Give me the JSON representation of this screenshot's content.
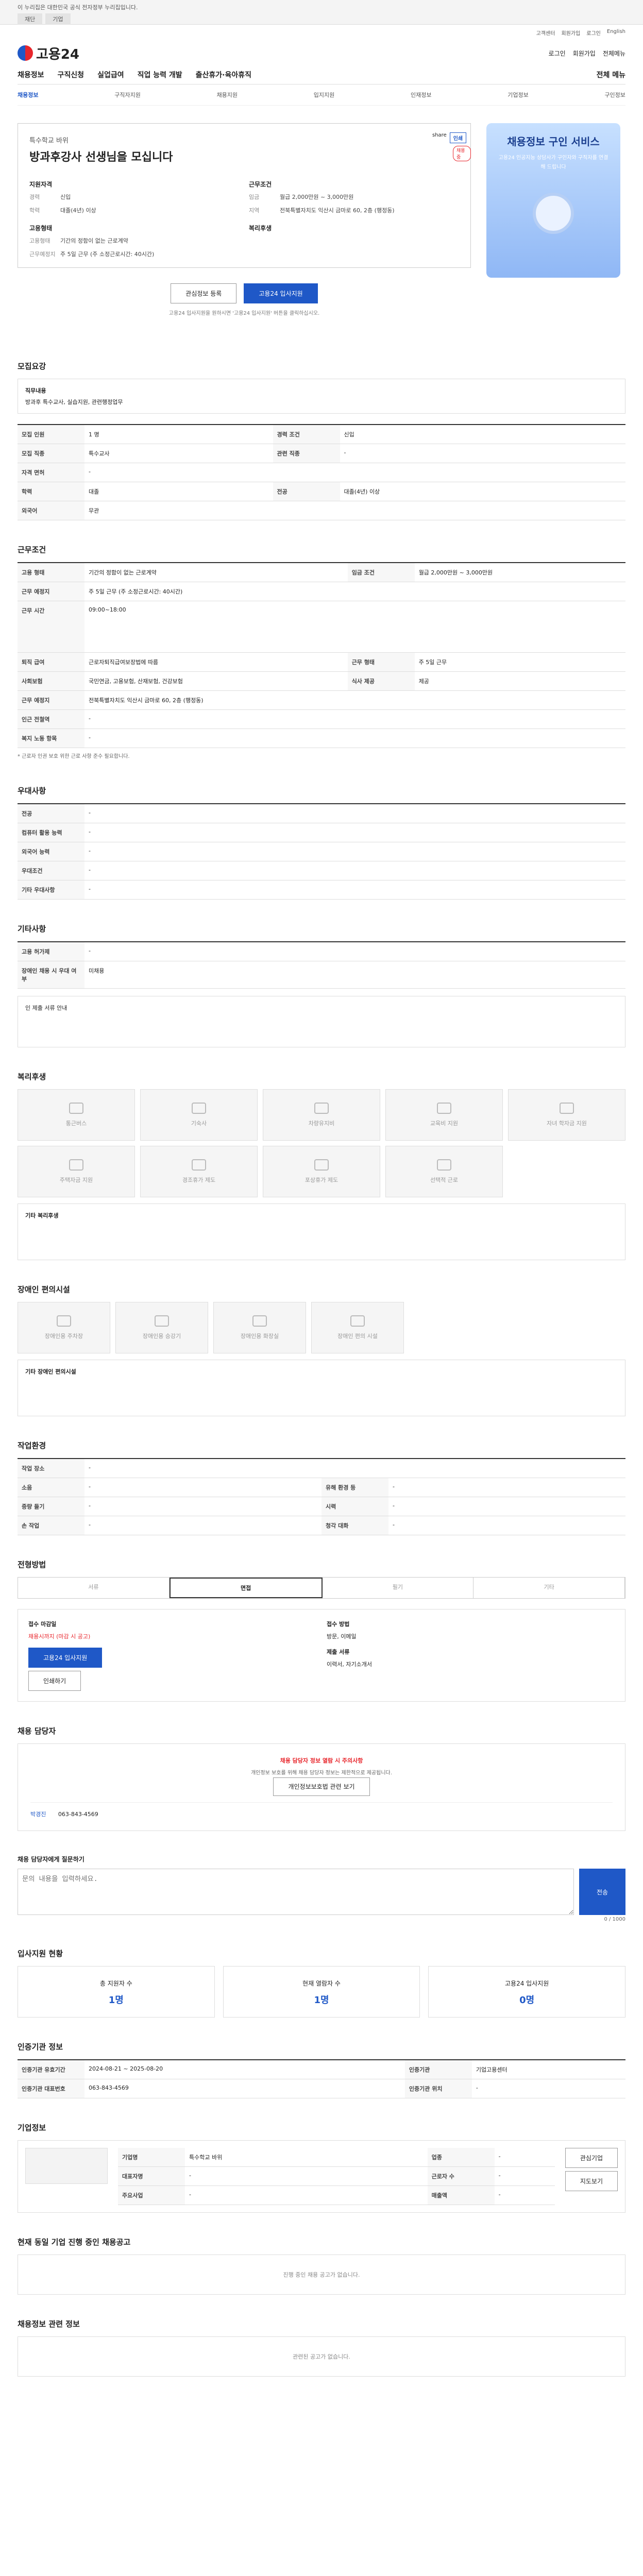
{
  "gov_banner": {
    "text": "이 누리집은 대한민국 공식 전자정부 누리집입니다.",
    "btn1": "재단",
    "btn2": "기업"
  },
  "util": [
    "고객센터",
    "회원가입",
    "로그인",
    "English"
  ],
  "header": {
    "logo": "고용24",
    "links": [
      "로그인",
      "회원가입",
      "전체메뉴"
    ]
  },
  "gnb": {
    "items": [
      "채용정보",
      "구직신청",
      "실업급여",
      "직업 능력 개발",
      "출산휴가·육아휴직"
    ],
    "right": "전체 메뉴"
  },
  "subnav": [
    "채용정보",
    "구직자지원",
    "채용지원",
    "입지지원",
    "인재정보",
    "기업정보",
    "구인정보"
  ],
  "job": {
    "company": "특수학교 바위",
    "title": "방과후강사 선생님을 모십니다",
    "share": "share",
    "print": "인쇄",
    "badge": "채용중",
    "left_heading": "지원자격",
    "left": [
      [
        "경력",
        "신입"
      ],
      [
        "학력",
        "대졸(4년) 이상"
      ]
    ],
    "left2_heading": "고용형태",
    "left2": [
      [
        "고용형태",
        "기간의 정함이 없는 근로계약"
      ],
      [
        "근무예정지",
        "주 5일 근무 (주 소정근로시간: 40시간)"
      ]
    ],
    "right_heading": "근무조건",
    "right": [
      [
        "임금",
        "월급 2,000만원 ~ 3,000만원"
      ],
      [
        "지역",
        "전북특별자치도 익산시 금마로 60, 2층 (행정동)"
      ]
    ],
    "right2_heading": "복리후생"
  },
  "ad": {
    "title": "채용정보 구인 서비스",
    "desc": "고용24 인공지능 상담사가 구인자와 구직자를 연결해 드립니다"
  },
  "actions": {
    "interest": "관심정보 등록",
    "apply": "고용24 입사지원"
  },
  "apply_note": "고용24 입사지원을 원하시면 '고용24 입사지원' 버튼을 클릭하십시오.",
  "sections": {
    "qual": "모집요강",
    "work": "근무조건",
    "pref": "우대사항",
    "etc": "기타사항",
    "welfare": "복리후생",
    "disabled": "장애인 편의시설",
    "env": "작업환경",
    "method": "전형방법",
    "manager": "채용 담당자",
    "status": "입사지원 현황",
    "cert": "인증기관 정보",
    "company": "기업정보",
    "similar": "현재 동일 기업 진행 중인 채용공고",
    "same": "채용정보 관련 정보"
  },
  "qual": {
    "summary_title": "직무내용",
    "summary": "방과후 특수교사, 실습지원, 관련행정업무",
    "rows": [
      [
        "모집 인원",
        "1 명",
        "경력 조건",
        "신입"
      ],
      [
        "모집 직종",
        "특수교사",
        "관련 직종",
        "-"
      ],
      [
        "자격 면허",
        "-",
        "",
        ""
      ],
      [
        "학력",
        "대졸",
        "전공",
        "대졸(4년) 이상"
      ],
      [
        "외국어",
        "무관",
        "",
        ""
      ]
    ]
  },
  "work": {
    "rows": [
      [
        "고용 형태",
        "기간의 정함이 없는 근로계약",
        "임금 조건",
        "월급 2,000만원 ~ 3,000만원"
      ],
      [
        "근무 예정지",
        "주 5일 근무 (주 소정근로시간: 40시간)",
        "",
        ""
      ],
      [
        "근무 시간",
        "09:00~18:00",
        "",
        ""
      ],
      [
        "퇴직 급여",
        "근로자퇴직급여보장법에 따름",
        "근무 형태",
        "주 5일 근무"
      ],
      [
        "사회보험",
        "국민연금, 고용보험, 산재보험, 건강보험",
        "식사 제공",
        "제공"
      ],
      [
        "근무 예정지",
        "전북특별자치도 익산시 금마로 60, 2층 (행정동)",
        "",
        ""
      ],
      [
        "인근 전철역",
        "-",
        "",
        ""
      ],
      [
        "복지 노동 항목",
        "-",
        "",
        ""
      ]
    ],
    "note": "* 근로자 인권 보호 위한 근로 사항 준수 필요합니다."
  },
  "pref": [
    [
      "전공",
      "-"
    ],
    [
      "컴퓨터 활용 능력",
      "-"
    ],
    [
      "외국어 능력",
      "-"
    ],
    [
      "우대조건",
      "-"
    ],
    [
      "기타 우대사항",
      "-"
    ]
  ],
  "etc": [
    [
      "고용 허가제",
      "-"
    ],
    [
      "장애인 채용 시 우대 여부",
      "미채용"
    ]
  ],
  "etc_box": "인 제출 서류 안내",
  "welfare": [
    "통근버스",
    "기숙사",
    "차량유지비",
    "교육비 지원",
    "자녀 학자금 지원",
    "주택자금 지원",
    "경조휴가 제도",
    "포상휴가 제도",
    "선택적 근로"
  ],
  "welfare_extra_title": "기타 복리후생",
  "disabled": [
    "장애인용 주차장",
    "장애인용 승강기",
    "장애인용 화장실",
    "장애인 편의 시설"
  ],
  "disabled_extra_title": "기타 장애인 편의시설",
  "env": [
    [
      "작업 장소",
      "-",
      "",
      ""
    ],
    [
      "소음",
      "-",
      "유해 환경 등",
      "-"
    ],
    [
      "중량 들기",
      "-",
      "시력",
      "-"
    ],
    [
      "손 작업",
      "-",
      "청각 대화",
      "-"
    ]
  ],
  "method": {
    "tabs": [
      "서류",
      "면접",
      "필기",
      "기타"
    ],
    "left_title": "접수 마감일",
    "deadline": "채용시까지 (마감 시 공고)",
    "right_title": "접수 방법",
    "how": "방문, 이메일",
    "docs_title": "제출 서류",
    "docs": "이력서, 자기소개서",
    "apply": "고용24 입사지원",
    "print": "인쇄하기"
  },
  "manager": {
    "alert": "채용 담당자 정보 열람 시 주의사항",
    "desc": "개인정보 보호를 위해 채용 담당자 정보는 제한적으로 제공됩니다.",
    "btn": "개인정보보호법 관련 보기",
    "name_tag": "박경진",
    "phone": "063-843-4569"
  },
  "contact": {
    "title": "채용 담당자에게 질문하기",
    "placeholder": "문의 내용을 입력하세요.",
    "send": "전송",
    "counter": "0 / 1000"
  },
  "status": [
    [
      "총 지원자 수",
      "1명"
    ],
    [
      "현재 열람자 수",
      "1명"
    ],
    [
      "고용24 입사지원",
      "0명"
    ]
  ],
  "cert": [
    [
      "인증기관 유효기간",
      "2024-08-21 ~ 2025-08-20",
      "인증기관",
      "기업고용센터"
    ],
    [
      "인증기관 대표번호",
      "063-843-4569",
      "인증기관 위치",
      "-"
    ]
  ],
  "company": [
    [
      "기업명",
      "특수학교 바위",
      "업종",
      "-"
    ],
    [
      "대표자명",
      "-",
      "근로자 수",
      "-"
    ],
    [
      "주요사업",
      "-",
      "매출액",
      "-"
    ]
  ],
  "company_btns": [
    "관심기업",
    "지도보기"
  ],
  "similar_empty": "진행 중인 채용 공고가 없습니다.",
  "same_empty": "관련된 공고가 없습니다."
}
